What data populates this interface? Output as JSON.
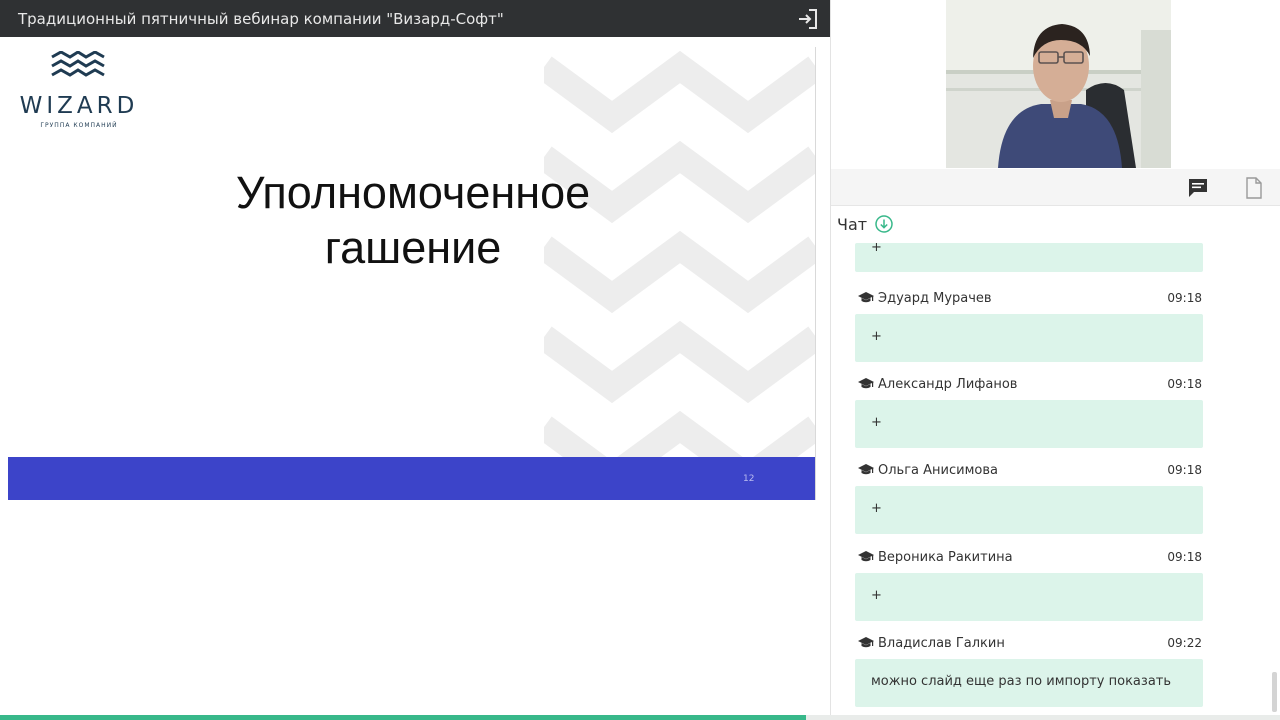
{
  "window": {
    "title": "Традиционный пятничный вебинар компании \"Визард-Софт\""
  },
  "slide": {
    "logo_text": "WIZARD",
    "logo_sub": "ГРУППА КОМПАНИЙ",
    "title_line1": "Уполномоченное",
    "title_line2": "гашение",
    "number": "12",
    "footer_color": "#3c44c9"
  },
  "panel": {
    "tabs": [
      {
        "icon": "chat-icon",
        "active": true
      },
      {
        "icon": "document-icon",
        "active": false
      }
    ]
  },
  "chat": {
    "title": "Чат",
    "scroll_down_icon": "arrow-down-circle-icon",
    "first_partial": {
      "text": "+"
    },
    "messages": [
      {
        "name": "Эдуард Мурачев",
        "time": "09:18",
        "text": "+"
      },
      {
        "name": "Александр Лифанов",
        "time": "09:18",
        "text": "+"
      },
      {
        "name": "Ольга Анисимова",
        "time": "09:18",
        "text": "+"
      },
      {
        "name": "Вероника Ракитина",
        "time": "09:18",
        "text": "+"
      },
      {
        "name": "Владислав Галкин",
        "time": "09:22",
        "text": "можно слайд еще раз по импорту показать"
      }
    ]
  },
  "progress": {
    "value": 0.63
  },
  "colors": {
    "accent": "#38b88a",
    "bubble": "#dcf4ea",
    "topbar": "#2f3133"
  }
}
